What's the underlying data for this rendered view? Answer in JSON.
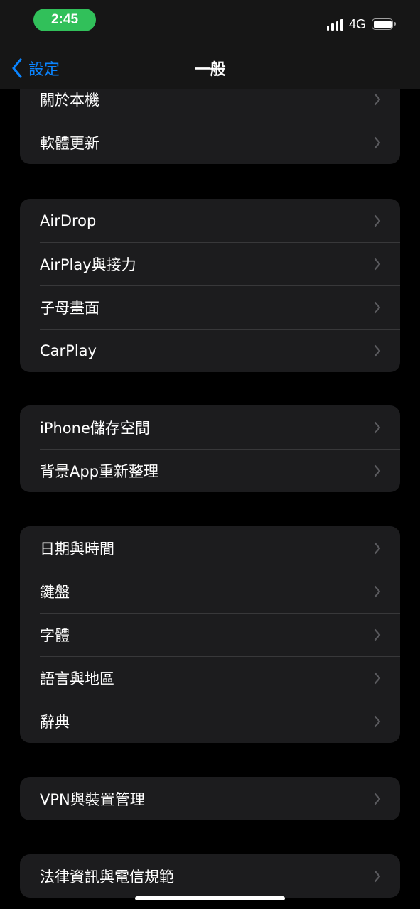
{
  "status_bar": {
    "time": "2:45",
    "network": "4G",
    "icons": [
      "signal-icon",
      "battery-icon"
    ]
  },
  "nav": {
    "back_label": "設定",
    "title": "一般",
    "back_color": "#0a84ff"
  },
  "groups": [
    {
      "items": [
        "關於本機",
        "軟體更新"
      ]
    },
    {
      "items": [
        "AirDrop",
        "AirPlay與接力",
        "子母畫面",
        "CarPlay"
      ]
    },
    {
      "items": [
        "iPhone儲存空間",
        "背景App重新整理"
      ]
    },
    {
      "items": [
        "日期與時間",
        "鍵盤",
        "字體",
        "語言與地區",
        "辭典"
      ]
    },
    {
      "items": [
        "VPN與裝置管理"
      ]
    },
    {
      "items": [
        "法律資訊與電信規範"
      ]
    }
  ],
  "colors": {
    "background": "#000000",
    "group_background": "#1c1c1e",
    "separator": "#38383a",
    "chevron": "#5a5a5e",
    "time_pill": "#31c05a"
  }
}
